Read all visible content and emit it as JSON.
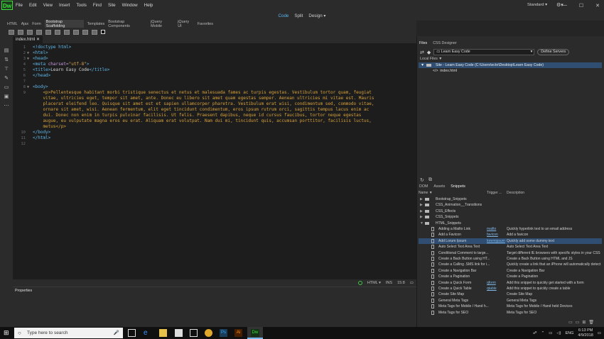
{
  "app": {
    "logo": "Dw",
    "workspace": "Standard",
    "window_controls": [
      "—",
      "☐",
      "✕"
    ]
  },
  "menu": [
    "File",
    "Edit",
    "View",
    "Insert",
    "Tools",
    "Find",
    "Site",
    "Window",
    "Help"
  ],
  "view_modes": {
    "code": "Code",
    "split": "Split",
    "design": "Design"
  },
  "insert_tabs": [
    "HTML",
    "Ajax",
    "Form",
    "Bootstrap Scaffolding",
    "Templates",
    "Bootstrap Components",
    "jQuery Mobile",
    "jQuery UI",
    "Favorites"
  ],
  "document_tab": "index.html",
  "code_lines": [
    {
      "n": "1",
      "fold": "",
      "html": "<span class='tag'>&lt;!doctype html&gt;</span>"
    },
    {
      "n": "2",
      "fold": "▼",
      "html": "<span class='tag'>&lt;html&gt;</span>"
    },
    {
      "n": "3",
      "fold": "▼",
      "html": "<span class='tag'>&lt;head&gt;</span>"
    },
    {
      "n": "4",
      "fold": "",
      "html": "<span class='tag'>&lt;meta</span> <span class='att'>charset=</span><span class='str'>\"utf-8\"</span><span class='tag'>&gt;</span>"
    },
    {
      "n": "5",
      "fold": "",
      "html": "<span class='tag'>&lt;title&gt;</span><span class='txt'>Learn Easy Code</span><span class='tag'>&lt;/title&gt;</span>"
    },
    {
      "n": "6",
      "fold": "",
      "html": "<span class='tag'>&lt;/head&gt;</span>"
    },
    {
      "n": "7",
      "fold": "",
      "html": ""
    },
    {
      "n": "8",
      "fold": "▼",
      "html": "<span class='tag'>&lt;body&gt;</span>"
    }
  ],
  "paragraph": {
    "n": "9",
    "lines": [
      "    <p>Pellentesque habitant morbi tristique senectus et netus et malesuada fames ac turpis egestas. Vestibulum tortor quam, feugiat",
      "    vitae, ultricies eget, tempor sit amet, ante. Donec eu libero sit amet quam egestas semper. Aenean ultricies mi vitae est. Mauris",
      "    placerat eleifend leo. Quisque sit amet est et sapien ullamcorper pharetra. Vestibulum erat wisi, condimentum sed, commodo vitae,",
      "    ornare sit amet, wisi. Aenean fermentum, elit eget tincidunt condimentum, eros ipsum rutrum orci, sagittis tempus lacus enim ac",
      "    dui. Donec non enim in turpis pulvinar facilisis. Ut felis. Praesent dapibus, neque id cursus faucibus, tortor neque egestas",
      "    augue, eu vulputate magna eros eu erat. Aliquam erat volutpat. Nam dui mi, tincidunt quis, accumsan porttitor, facilisis luctus,",
      "    metus</p>"
    ]
  },
  "code_tail": [
    {
      "n": "10",
      "html": "<span class='tag'>&lt;/body&gt;</span>"
    },
    {
      "n": "11",
      "html": "<span class='tag'>&lt;/html&gt;</span>"
    },
    {
      "n": "12",
      "html": ""
    }
  ],
  "status": {
    "language": "HTML",
    "mode": "INS",
    "position": "15:8"
  },
  "properties_title": "Properties",
  "files_panel": {
    "tabs": [
      "Files",
      "CSS Designer"
    ],
    "site": "Learn Easy Code",
    "define": "Define Servers",
    "local_label": "Local Files ▼",
    "site_root": "Site - Learn Easy Code (C:\\Users\\ecto\\Desktop\\Learn Easy Code)",
    "file": "index.html"
  },
  "snippets_panel": {
    "tabs": [
      "DOM",
      "Assets",
      "Snippets"
    ],
    "cols": [
      "Name ▼",
      "Trigger ...",
      "Description"
    ],
    "folders": [
      "Bootstrap_Snippets",
      "CSS_Animation__Transitions",
      "CSS_Effects",
      "CSS_Snippets",
      "HTML_Snippets"
    ],
    "items": [
      {
        "name": "Adding a Mailto Link",
        "trigger": "mailto",
        "desc": "Quickly hyperlink text to an email address"
      },
      {
        "name": "Add a Favicon",
        "trigger": "favicon",
        "desc": "Add a favicon"
      },
      {
        "name": "Add Lorum Ipsum",
        "trigger": "loremipsum",
        "desc": "Quickly add some dummy text"
      },
      {
        "name": "Auto Select Text Area Text",
        "trigger": "",
        "desc": "Auto Select Text Area Text"
      },
      {
        "name": "Conditional Comment to targe...",
        "trigger": "",
        "desc": "Target different IE browsers with specific styles in your CSS"
      },
      {
        "name": "Create a Back Button using HT...",
        "trigger": "",
        "desc": "Create a Back Button using HTML and JS"
      },
      {
        "name": "Create a Calling .SMS link for i...",
        "trigger": "",
        "desc": "Quickly create a link that an iPhone will automatically detect"
      },
      {
        "name": "Create a Navigation Bar",
        "trigger": "",
        "desc": "Create a Navigation Bar"
      },
      {
        "name": "Create a Pagination",
        "trigger": "",
        "desc": "Create a Pagination"
      },
      {
        "name": "Create a Quick Form",
        "trigger": "qform",
        "desc": "Add this snippet to quickly get started with a form"
      },
      {
        "name": "Create a Quick Table",
        "trigger": "qtable",
        "desc": "Add this snippet to quickly create a table"
      },
      {
        "name": "Create Site Map",
        "trigger": "",
        "desc": "Create Site Map"
      },
      {
        "name": "General Meta Tags",
        "trigger": "",
        "desc": "General Meta Tags"
      },
      {
        "name": "Meta Tags for Mobile / Hand h...",
        "trigger": "",
        "desc": "Meta Tags for Mobile / Hand held Devices"
      },
      {
        "name": "Meta Tags for SEO",
        "trigger": "",
        "desc": "Meta Tags for SEO"
      }
    ],
    "selected_index": 2
  },
  "taskbar": {
    "search_placeholder": "Type here to search",
    "lang": "ENG",
    "time": "6:13 PM",
    "date": "4/9/2018"
  }
}
